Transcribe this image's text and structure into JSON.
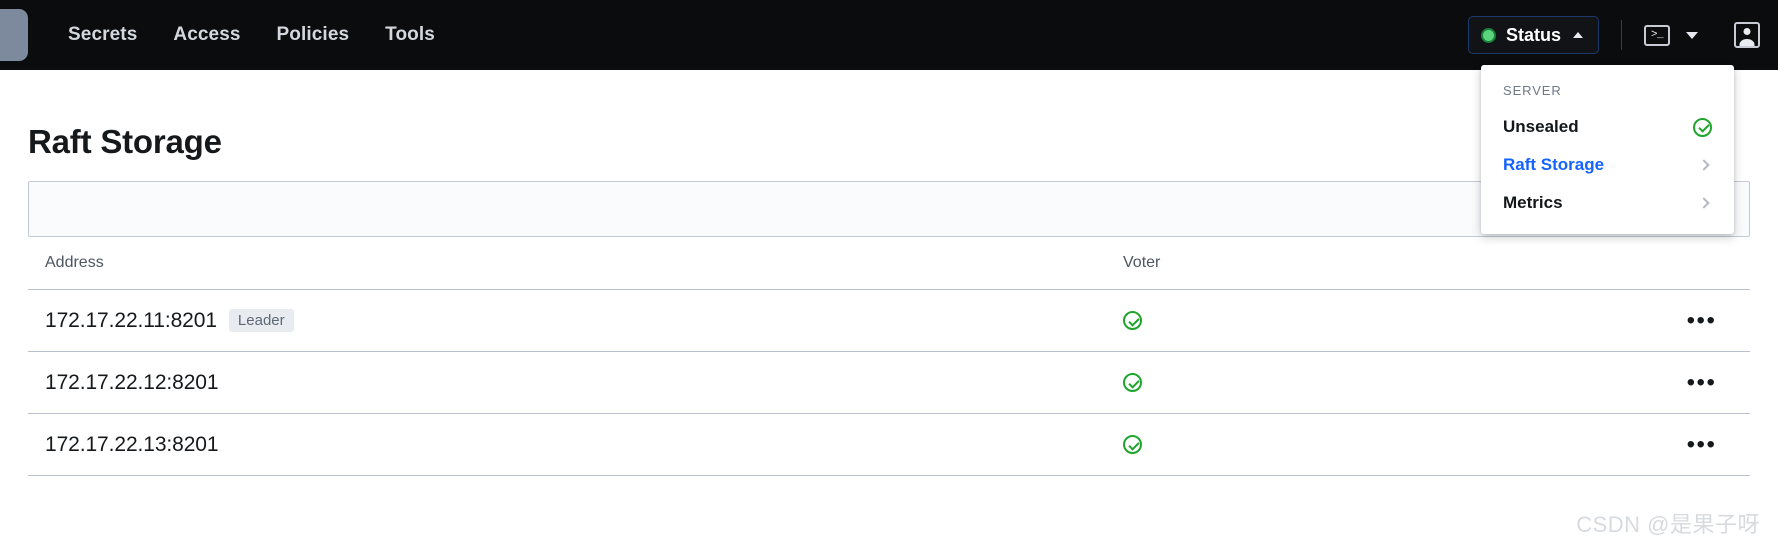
{
  "navbar": {
    "logo_icon": "vault-logo-icon",
    "links": [
      {
        "label": "Secrets"
      },
      {
        "label": "Access"
      },
      {
        "label": "Policies"
      },
      {
        "label": "Tools"
      }
    ],
    "status_button": {
      "label": "Status",
      "indicator_color": "#5bd47e",
      "caret_icon": "chevron-up-icon",
      "expanded": true
    },
    "console_icon": "terminal-icon",
    "console_caret_icon": "chevron-down-icon",
    "user_icon": "user-avatar-icon"
  },
  "status_dropdown": {
    "section_title": "SERVER",
    "items": [
      {
        "label": "Unsealed",
        "trailing_icon": "check-circle-icon",
        "accent": false
      },
      {
        "label": "Raft Storage",
        "trailing_icon": "chevron-right-icon",
        "accent": true
      },
      {
        "label": "Metrics",
        "trailing_icon": "chevron-right-icon",
        "accent": false
      }
    ],
    "accent_color": "#1563ff",
    "success_color": "#1fa52c"
  },
  "main": {
    "title": "Raft Storage",
    "toolbar": {
      "content": ""
    },
    "table": {
      "columns": [
        {
          "key": "address",
          "label": "Address"
        },
        {
          "key": "voter",
          "label": "Voter"
        },
        {
          "key": "actions",
          "label": ""
        }
      ],
      "rows": [
        {
          "address": "172.17.22.11:8201",
          "badge": "Leader",
          "voter_icon": "check-circle-icon",
          "actions_icon": "kebab-menu-icon",
          "actions_glyph": "•••"
        },
        {
          "address": "172.17.22.12:8201",
          "badge": "",
          "voter_icon": "check-circle-icon",
          "actions_icon": "kebab-menu-icon",
          "actions_glyph": "•••"
        },
        {
          "address": "172.17.22.13:8201",
          "badge": "",
          "voter_icon": "check-circle-icon",
          "actions_icon": "kebab-menu-icon",
          "actions_glyph": "•••"
        }
      ]
    }
  },
  "watermark": {
    "text": "CSDN @是果子呀"
  }
}
